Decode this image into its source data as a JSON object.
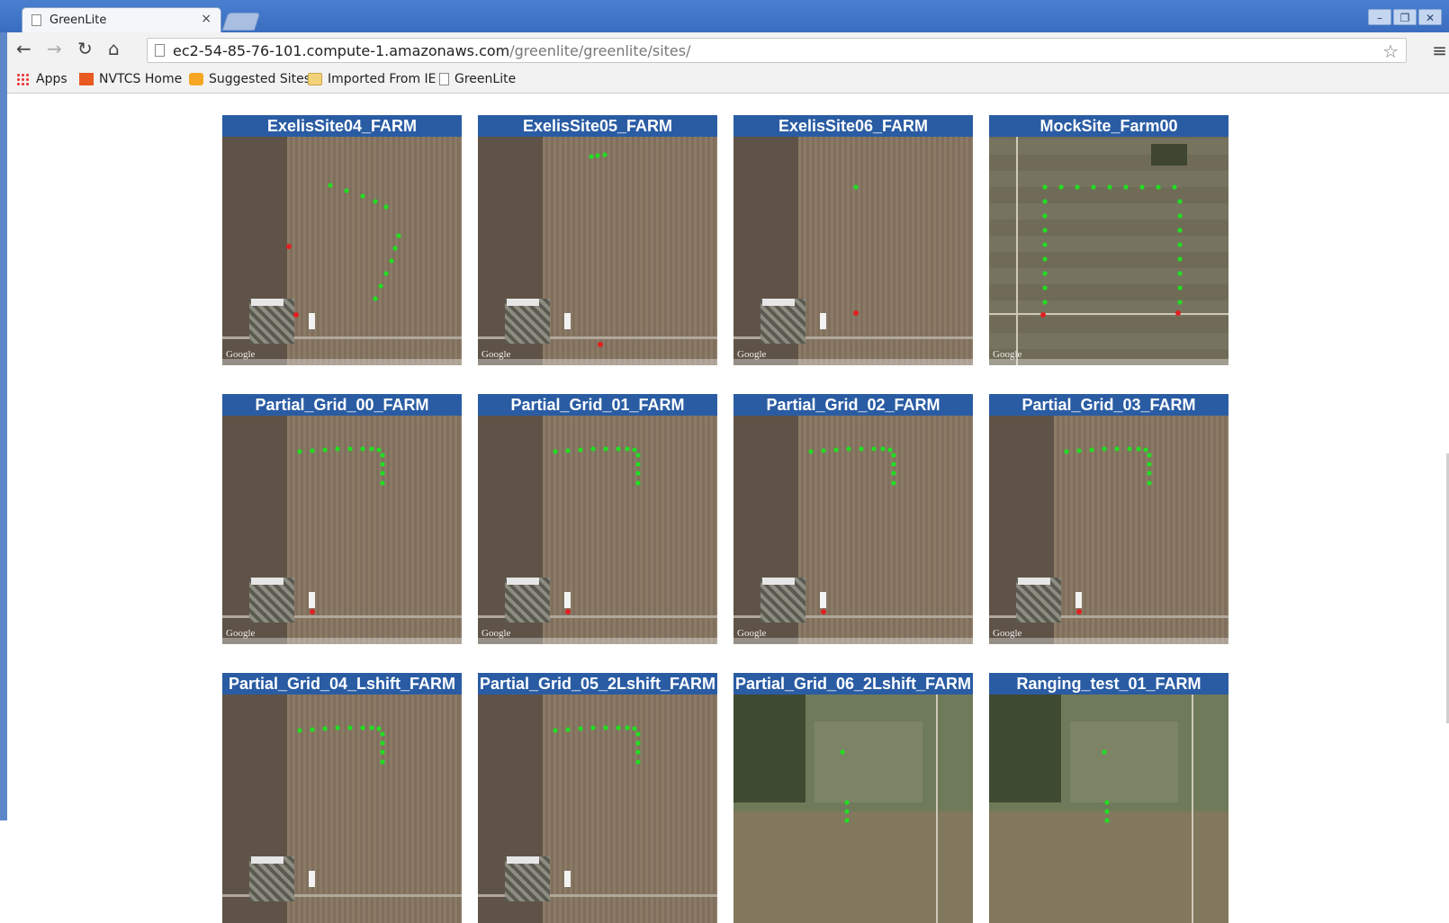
{
  "browser": {
    "tab_title": "GreenLite",
    "tab_close_glyph": "×",
    "url_host": "ec2-54-85-76-101.compute-1.amazonaws.com",
    "url_path": "/greenlite/greenlite/sites/",
    "window_buttons": [
      "–",
      "❐",
      "✕"
    ]
  },
  "icons": {
    "back": "back-arrow-icon",
    "forward": "forward-arrow-icon",
    "reload": "reload-icon",
    "home": "home-icon",
    "star": "bookmark-star-icon",
    "menu": "menu-icon"
  },
  "bookmarks": [
    {
      "label": "Apps",
      "icon": "apps-grid-icon"
    },
    {
      "label": "NVTCS Home",
      "icon": "nvtcs-icon"
    },
    {
      "label": "Suggested Sites",
      "icon": "suggested-sites-icon"
    },
    {
      "label": "Imported From IE",
      "icon": "folder-icon"
    },
    {
      "label": "GreenLite",
      "icon": "page-icon"
    }
  ],
  "colors": {
    "header_blue": "#2a5ca3",
    "sensor_green": "#22dd22",
    "marker_red": "#e02020"
  },
  "sites": [
    {
      "title": "ExelisSite04_FARM",
      "map_credit": "Google"
    },
    {
      "title": "ExelisSite05_FARM",
      "map_credit": "Google"
    },
    {
      "title": "ExelisSite06_FARM",
      "map_credit": "Google"
    },
    {
      "title": "MockSite_Farm00",
      "map_credit": "Google"
    },
    {
      "title": "Partial_Grid_00_FARM",
      "map_credit": "Google"
    },
    {
      "title": "Partial_Grid_01_FARM",
      "map_credit": "Google"
    },
    {
      "title": "Partial_Grid_02_FARM",
      "map_credit": "Google"
    },
    {
      "title": "Partial_Grid_03_FARM",
      "map_credit": "Google"
    },
    {
      "title": "Partial_Grid_04_Lshift_FARM",
      "map_credit": ""
    },
    {
      "title": "Partial_Grid_05_2Lshift_FARM",
      "map_credit": ""
    },
    {
      "title": "Partial_Grid_06_2Lshift_FARM",
      "map_credit": ""
    },
    {
      "title": "Ranging_test_01_FARM",
      "map_credit": ""
    }
  ]
}
